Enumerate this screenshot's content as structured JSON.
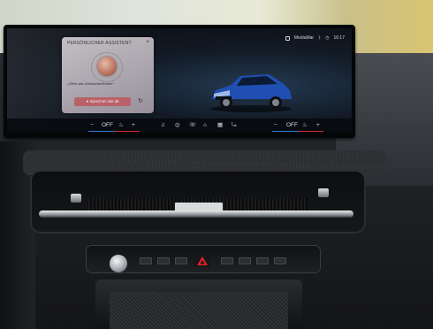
{
  "status_bar": {
    "source": "MediaMar",
    "clock": "16:17"
  },
  "assistant_widget": {
    "title": "PERSÖNLICHER ASSISTENT",
    "caption": "„Öffne das Glühkartenfenster“",
    "button_label": "Sprechen Sie alt"
  },
  "climate_bar": {
    "left_minus": "−",
    "left_value": "OFF",
    "left_plus": "+",
    "right_minus": "−",
    "right_value": "OFF",
    "right_plus": "+"
  },
  "icons": {
    "seat_heat_left": "seat-heat-icon",
    "seat_heat_right": "seat-heat-icon",
    "nav": "navigation-icon",
    "home": "home-icon",
    "apps": "apps-grid-icon",
    "fan": "fan-icon",
    "music": "music-note-icon",
    "car": "car-icon",
    "hazard": "hazard-warning-icon"
  },
  "colors": {
    "accent_red": "#d8282f",
    "accent_blue": "#2f7bd8",
    "widget_button": "#b9626a",
    "car_body": "#1f4fb3"
  }
}
